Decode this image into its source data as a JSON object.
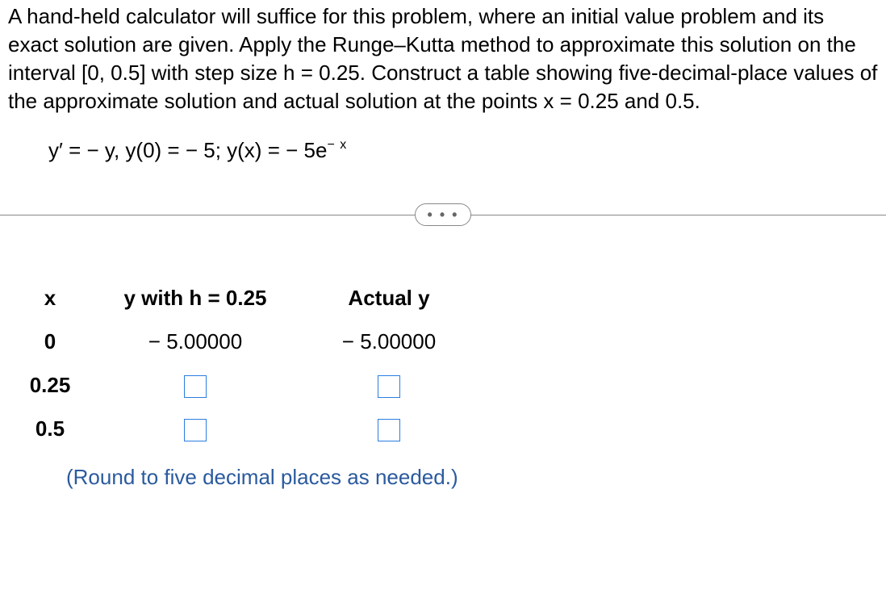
{
  "problem": {
    "text": "A hand-held calculator will suffice for this problem, where an initial value problem and its exact solution are given. Apply the Runge–Kutta method to approximate this solution on the interval [0, 0.5] with step size h = 0.25. Construct a table showing five-decimal-place values of the approximate solution and actual solution at the points x = 0.25 and 0.5."
  },
  "equation": {
    "body": "y′ = − y, y(0) = − 5; y(x) = − 5e",
    "exp": "− x"
  },
  "more_button": "• • •",
  "table": {
    "headers": {
      "x": "x",
      "approx": "y with h = 0.25",
      "actual": "Actual y"
    },
    "rows": [
      {
        "x": "0",
        "approx": "− 5.00000",
        "actual": "− 5.00000",
        "input": false
      },
      {
        "x": "0.25",
        "approx": "",
        "actual": "",
        "input": true
      },
      {
        "x": "0.5",
        "approx": "",
        "actual": "",
        "input": true
      }
    ]
  },
  "hint": "(Round to five decimal places as needed.)"
}
